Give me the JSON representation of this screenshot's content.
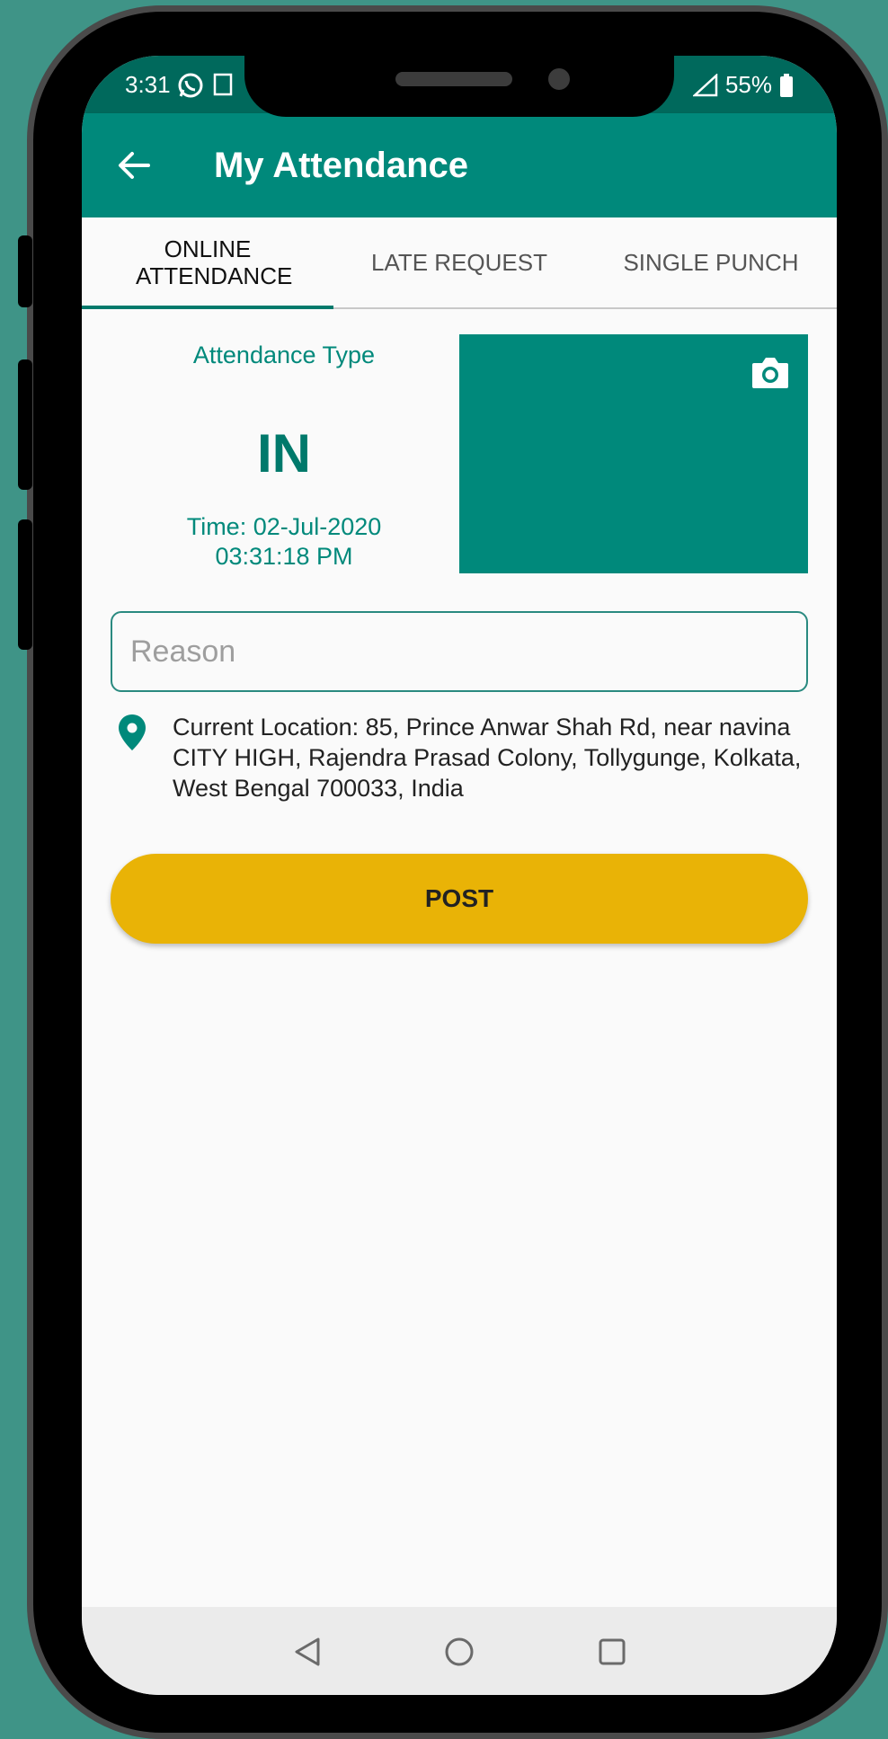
{
  "status": {
    "time": "3:31",
    "battery": "55%"
  },
  "appbar": {
    "title": "My Attendance"
  },
  "tabs": [
    {
      "label": "ONLINE ATTENDANCE",
      "active": true
    },
    {
      "label": "LATE REQUEST",
      "active": false
    },
    {
      "label": "SINGLE PUNCH",
      "active": false
    }
  ],
  "attendance": {
    "type_label": "Attendance Type",
    "type_value": "IN",
    "time_line1": "Time: 02-Jul-2020",
    "time_line2": "03:31:18 PM"
  },
  "reason": {
    "placeholder": "Reason",
    "value": ""
  },
  "location": {
    "text": "Current Location: 85, Prince Anwar Shah Rd, near navina CITY HIGH, Rajendra Prasad Colony, Tollygunge, Kolkata, West Bengal 700033, India"
  },
  "post_button": {
    "label": "POST"
  },
  "colors": {
    "primary": "#00897b",
    "primary_dark": "#00695c",
    "accent": "#e9b306",
    "background": "#3f9487"
  },
  "icons": [
    "back-arrow-icon",
    "camera-icon",
    "location-pin-icon",
    "whatsapp-icon",
    "signal-icon",
    "battery-icon",
    "nav-back-icon",
    "nav-home-icon",
    "nav-recents-icon"
  ]
}
